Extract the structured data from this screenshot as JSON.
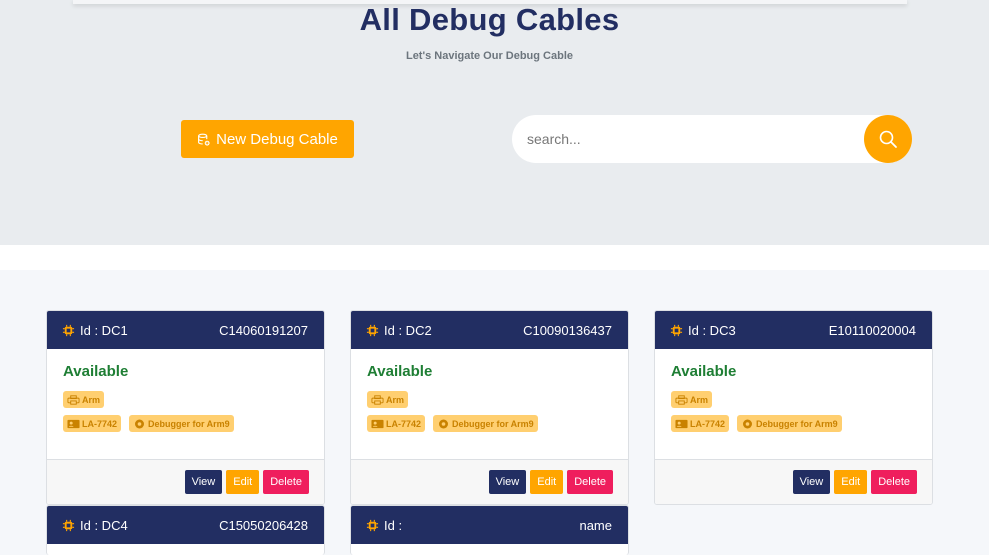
{
  "header": {
    "title": "All Debug Cables",
    "subtitle": "Let's Navigate Our Debug Cable",
    "new_button_label": "New Debug Cable"
  },
  "search": {
    "placeholder": "search...",
    "value": ""
  },
  "colors": {
    "navy": "#222e62",
    "accent": "#ffa500",
    "available": "#1e7e34",
    "delete": "#ef1e5d"
  },
  "cards": [
    {
      "id_label": "Id : DC1",
      "serial": "C14060191207",
      "status": "Available",
      "tags": [
        "Arm",
        "LA-7742",
        "Debugger for Arm9"
      ],
      "view": "View",
      "edit": "Edit",
      "delete": "Delete"
    },
    {
      "id_label": "Id : DC2",
      "serial": "C10090136437",
      "status": "Available",
      "tags": [
        "Arm",
        "LA-7742",
        "Debugger for Arm9"
      ],
      "view": "View",
      "edit": "Edit",
      "delete": "Delete"
    },
    {
      "id_label": "Id : DC3",
      "serial": "E10110020004",
      "status": "Available",
      "tags": [
        "Arm",
        "LA-7742",
        "Debugger for Arm9"
      ],
      "view": "View",
      "edit": "Edit",
      "delete": "Delete"
    },
    {
      "id_label": "Id : DC4",
      "serial": "C15050206428"
    },
    {
      "id_label": "Id :",
      "serial": "name"
    }
  ]
}
